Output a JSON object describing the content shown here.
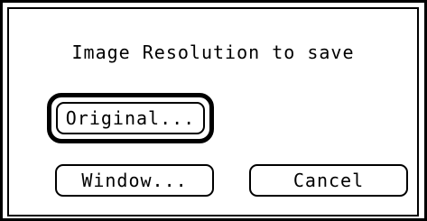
{
  "dialog": {
    "title": "Image Resolution to save",
    "buttons": {
      "original_label": "Original...",
      "window_label": "Window...",
      "cancel_label": "Cancel"
    },
    "default_button": "original"
  }
}
